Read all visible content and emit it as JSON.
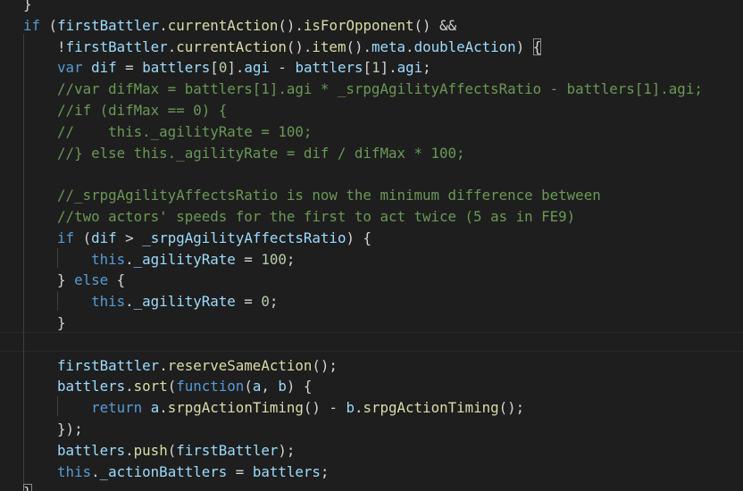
{
  "editor": {
    "theme": {
      "background": "#1e1e1e",
      "keyword": "#569cd6",
      "function": "#dcdcaa",
      "variable": "#9cdcfe",
      "comment": "#6a9955",
      "number": "#b5cea8",
      "text": "#d4d4d4"
    },
    "lines": [
      [
        {
          "t": "}",
          "c": "op"
        }
      ],
      [
        {
          "t": "if",
          "c": "kw"
        },
        {
          "t": " (",
          "c": "op"
        },
        {
          "t": "firstBattler",
          "c": "vr"
        },
        {
          "t": ".",
          "c": "op"
        },
        {
          "t": "currentAction",
          "c": "fn"
        },
        {
          "t": "().",
          "c": "op"
        },
        {
          "t": "isForOpponent",
          "c": "fn"
        },
        {
          "t": "() &&",
          "c": "op"
        }
      ],
      [
        {
          "t": "    !",
          "c": "op"
        },
        {
          "t": "firstBattler",
          "c": "vr"
        },
        {
          "t": ".",
          "c": "op"
        },
        {
          "t": "currentAction",
          "c": "fn"
        },
        {
          "t": "().",
          "c": "op"
        },
        {
          "t": "item",
          "c": "fn"
        },
        {
          "t": "().",
          "c": "op"
        },
        {
          "t": "meta",
          "c": "vr"
        },
        {
          "t": ".",
          "c": "op"
        },
        {
          "t": "doubleAction",
          "c": "vr"
        },
        {
          "t": ") ",
          "c": "op"
        },
        {
          "t": "{",
          "c": "op bm"
        }
      ],
      [
        {
          "t": "    ",
          "c": "op"
        },
        {
          "t": "var",
          "c": "kw"
        },
        {
          "t": " ",
          "c": "op"
        },
        {
          "t": "dif",
          "c": "vr"
        },
        {
          "t": " = ",
          "c": "op"
        },
        {
          "t": "battlers",
          "c": "vr"
        },
        {
          "t": "[",
          "c": "op"
        },
        {
          "t": "0",
          "c": "nm"
        },
        {
          "t": "].",
          "c": "op"
        },
        {
          "t": "agi",
          "c": "vr"
        },
        {
          "t": " - ",
          "c": "op"
        },
        {
          "t": "battlers",
          "c": "vr"
        },
        {
          "t": "[",
          "c": "op"
        },
        {
          "t": "1",
          "c": "nm"
        },
        {
          "t": "].",
          "c": "op"
        },
        {
          "t": "agi",
          "c": "vr"
        },
        {
          "t": ";",
          "c": "op"
        }
      ],
      [
        {
          "t": "    //var difMax = battlers[1].agi * _srpgAgilityAffectsRatio - battlers[1].agi;",
          "c": "cm"
        }
      ],
      [
        {
          "t": "    //if (difMax == 0) {",
          "c": "cm"
        }
      ],
      [
        {
          "t": "    //    this._agilityRate = 100;",
          "c": "cm"
        }
      ],
      [
        {
          "t": "    //} else this._agilityRate = dif / difMax * 100;",
          "c": "cm"
        }
      ],
      [],
      [
        {
          "t": "    //_srpgAgilityAffectsRatio is now the minimum difference between",
          "c": "cm"
        }
      ],
      [
        {
          "t": "    //two actors' speeds for the first to act twice (5 as in FE9)",
          "c": "cm"
        }
      ],
      [
        {
          "t": "    ",
          "c": "op"
        },
        {
          "t": "if",
          "c": "kw"
        },
        {
          "t": " (",
          "c": "op"
        },
        {
          "t": "dif",
          "c": "vr"
        },
        {
          "t": " > ",
          "c": "op"
        },
        {
          "t": "_srpgAgilityAffectsRatio",
          "c": "vr"
        },
        {
          "t": ") {",
          "c": "op"
        }
      ],
      [
        {
          "t": "        ",
          "c": "op"
        },
        {
          "t": "this",
          "c": "kw"
        },
        {
          "t": ".",
          "c": "op"
        },
        {
          "t": "_agilityRate",
          "c": "vr"
        },
        {
          "t": " = ",
          "c": "op"
        },
        {
          "t": "100",
          "c": "nm"
        },
        {
          "t": ";",
          "c": "op"
        }
      ],
      [
        {
          "t": "    } ",
          "c": "op"
        },
        {
          "t": "else",
          "c": "kw"
        },
        {
          "t": " {",
          "c": "op"
        }
      ],
      [
        {
          "t": "        ",
          "c": "op"
        },
        {
          "t": "this",
          "c": "kw"
        },
        {
          "t": ".",
          "c": "op"
        },
        {
          "t": "_agilityRate",
          "c": "vr"
        },
        {
          "t": " = ",
          "c": "op"
        },
        {
          "t": "0",
          "c": "nm"
        },
        {
          "t": ";",
          "c": "op"
        }
      ],
      [
        {
          "t": "    }",
          "c": "op"
        }
      ],
      [],
      [
        {
          "t": "    ",
          "c": "op"
        },
        {
          "t": "firstBattler",
          "c": "vr"
        },
        {
          "t": ".",
          "c": "op"
        },
        {
          "t": "reserveSameAction",
          "c": "fn"
        },
        {
          "t": "();",
          "c": "op"
        }
      ],
      [
        {
          "t": "    ",
          "c": "op"
        },
        {
          "t": "battlers",
          "c": "vr"
        },
        {
          "t": ".",
          "c": "op"
        },
        {
          "t": "sort",
          "c": "fn"
        },
        {
          "t": "(",
          "c": "op"
        },
        {
          "t": "function",
          "c": "kw"
        },
        {
          "t": "(",
          "c": "op"
        },
        {
          "t": "a",
          "c": "vr"
        },
        {
          "t": ", ",
          "c": "op"
        },
        {
          "t": "b",
          "c": "vr"
        },
        {
          "t": ") {",
          "c": "op"
        }
      ],
      [
        {
          "t": "        ",
          "c": "op"
        },
        {
          "t": "return",
          "c": "kw"
        },
        {
          "t": " ",
          "c": "op"
        },
        {
          "t": "a",
          "c": "vr"
        },
        {
          "t": ".",
          "c": "op"
        },
        {
          "t": "srpgActionTiming",
          "c": "fn"
        },
        {
          "t": "() - ",
          "c": "op"
        },
        {
          "t": "b",
          "c": "vr"
        },
        {
          "t": ".",
          "c": "op"
        },
        {
          "t": "srpgActionTiming",
          "c": "fn"
        },
        {
          "t": "();",
          "c": "op"
        }
      ],
      [
        {
          "t": "    });",
          "c": "op"
        }
      ],
      [
        {
          "t": "    ",
          "c": "op"
        },
        {
          "t": "battlers",
          "c": "vr"
        },
        {
          "t": ".",
          "c": "op"
        },
        {
          "t": "push",
          "c": "fn"
        },
        {
          "t": "(",
          "c": "op"
        },
        {
          "t": "firstBattler",
          "c": "vr"
        },
        {
          "t": ");",
          "c": "op"
        }
      ],
      [
        {
          "t": "    ",
          "c": "op"
        },
        {
          "t": "this",
          "c": "kw"
        },
        {
          "t": ".",
          "c": "op"
        },
        {
          "t": "_actionBattlers",
          "c": "vr"
        },
        {
          "t": " = ",
          "c": "op"
        },
        {
          "t": "battlers",
          "c": "vr"
        },
        {
          "t": ";",
          "c": "op"
        }
      ],
      [
        {
          "t": "}",
          "c": "op bm"
        }
      ]
    ]
  }
}
